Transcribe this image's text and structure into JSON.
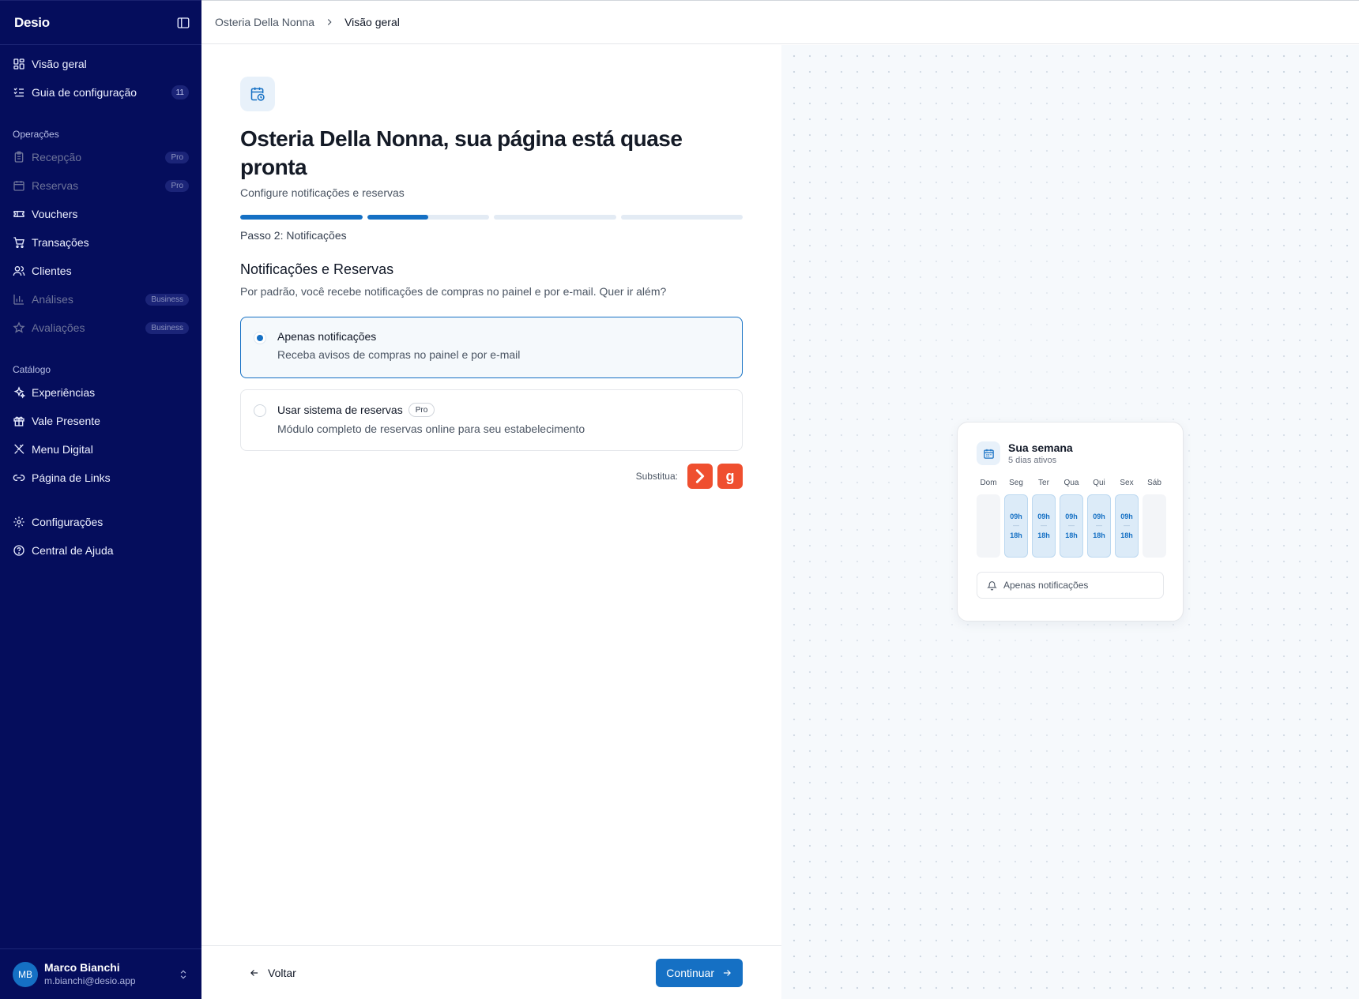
{
  "sidebar": {
    "logo": "Desio",
    "items_top": [
      {
        "label": "Visão geral",
        "icon": "layout-grid-icon"
      },
      {
        "label": "Guia de configuração",
        "icon": "checklist-icon",
        "badge": "11"
      }
    ],
    "section_operations": "Operações",
    "items_operations": [
      {
        "label": "Recepção",
        "icon": "clipboard-icon",
        "badge": "Pro",
        "disabled": true
      },
      {
        "label": "Reservas",
        "icon": "calendar-icon",
        "badge": "Pro",
        "disabled": true
      },
      {
        "label": "Vouchers",
        "icon": "ticket-icon"
      },
      {
        "label": "Transações",
        "icon": "cart-icon"
      },
      {
        "label": "Clientes",
        "icon": "users-icon"
      },
      {
        "label": "Análises",
        "icon": "bar-chart-icon",
        "badge": "Business",
        "disabled": true
      },
      {
        "label": "Avaliações",
        "icon": "star-icon",
        "badge": "Business",
        "disabled": true
      }
    ],
    "section_catalog": "Catálogo",
    "items_catalog": [
      {
        "label": "Experiências",
        "icon": "sparkles-icon"
      },
      {
        "label": "Vale Presente",
        "icon": "gift-icon"
      },
      {
        "label": "Menu Digital",
        "icon": "utensils-icon"
      },
      {
        "label": "Página de Links",
        "icon": "link-icon"
      }
    ],
    "items_bottom": [
      {
        "label": "Configurações",
        "icon": "gear-icon"
      },
      {
        "label": "Central de Ajuda",
        "icon": "help-circle-icon"
      }
    ],
    "user": {
      "initials": "MB",
      "name": "Marco Bianchi",
      "email": "m.bianchi@desio.app"
    }
  },
  "breadcrumb": {
    "parent": "Osteria Della Nonna",
    "current": "Visão geral"
  },
  "main": {
    "title": "Osteria Della Nonna, sua página está quase pronta",
    "subtitle": "Configure notificações e reservas",
    "progress": [
      1.0,
      0.5,
      0.0,
      0.0
    ],
    "step_label": "Passo 2: Notificações",
    "section_title": "Notificações e Reservas",
    "section_desc": "Por padrão, você recebe notificações de compras no painel e por e-mail. Quer ir além?",
    "options": [
      {
        "title": "Apenas notificações",
        "desc": "Receba avisos de compras no painel e por e-mail",
        "selected": true
      },
      {
        "title": "Usar sistema de reservas",
        "badge": "Pro",
        "desc": "Módulo completo de reservas online para seu estabelecimento",
        "selected": false
      }
    ],
    "replaces_label": "Substitua:",
    "replaces_brands": [
      "brand-arrow-icon",
      "brand-g-icon"
    ],
    "brand_g_glyph": "g",
    "back_label": "Voltar",
    "continue_label": "Continuar",
    "accent": "#1570c4"
  },
  "preview": {
    "card_title": "Sua semana",
    "card_sub": "5 dias ativos",
    "days": [
      {
        "name": "Dom",
        "active": false
      },
      {
        "name": "Seg",
        "active": true,
        "open": "09h",
        "close": "18h"
      },
      {
        "name": "Ter",
        "active": true,
        "open": "09h",
        "close": "18h"
      },
      {
        "name": "Qua",
        "active": true,
        "open": "09h",
        "close": "18h"
      },
      {
        "name": "Qui",
        "active": true,
        "open": "09h",
        "close": "18h"
      },
      {
        "name": "Sex",
        "active": true,
        "open": "09h",
        "close": "18h"
      },
      {
        "name": "Sáb",
        "active": false
      }
    ],
    "dash": "—",
    "status": "Apenas notificações"
  }
}
